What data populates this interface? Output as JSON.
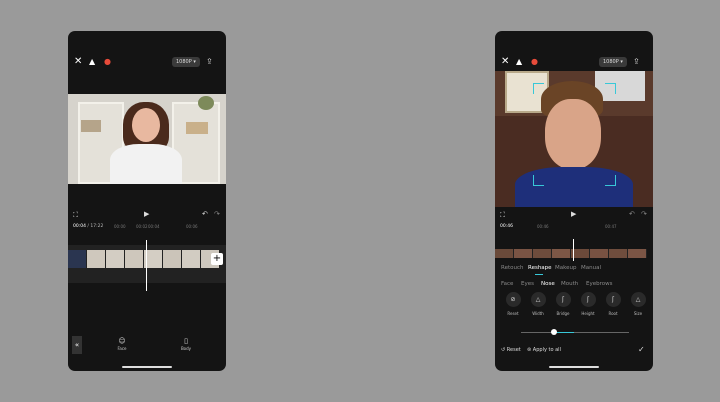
{
  "left_phone": {
    "resolution": "1080P",
    "time_current": "00:04",
    "time_total": "17:22",
    "ruler_ticks": [
      "00:00",
      "00:02",
      "00:04",
      "00:06"
    ],
    "bottom_tools": [
      {
        "label": "Face",
        "icon": "face-icon"
      },
      {
        "label": "Body",
        "icon": "body-icon"
      }
    ]
  },
  "right_phone": {
    "resolution": "1080P",
    "time_current": "00:46",
    "ruler_ticks": [
      "00:46",
      "00:47"
    ],
    "main_tabs": [
      "Retouch",
      "Reshape",
      "Makeup",
      "Manual"
    ],
    "active_main_tab": "Reshape",
    "sub_tabs": [
      "Face",
      "Eyes",
      "Nose",
      "Mouth",
      "Eyebrows"
    ],
    "active_sub_tab": "Nose",
    "features": [
      {
        "label": "Reset"
      },
      {
        "label": "Width"
      },
      {
        "label": "Bridge"
      },
      {
        "label": "Height"
      },
      {
        "label": "Root"
      },
      {
        "label": "Size"
      }
    ],
    "reset_label": "Reset",
    "apply_all_label": "Apply to all",
    "slider_value_pct": 20
  },
  "colors": {
    "accent": "#38c8d8",
    "background": "#9a9a9a",
    "phone_bg": "#141414"
  }
}
